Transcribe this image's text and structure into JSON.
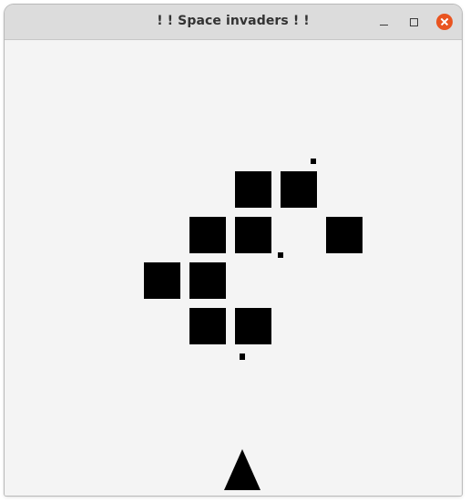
{
  "window": {
    "title": "! ! Space invaders ! !"
  },
  "colors": {
    "titlebar": "#dcdcdc",
    "background": "#f4f4f4",
    "sprites": "#000000",
    "close_button": "#e95420"
  },
  "icons": {
    "minimize": "minimize-icon",
    "maximize": "maximize-icon",
    "close": "close-icon"
  },
  "game": {
    "invader_count": 9,
    "player_shots": 1,
    "enemy_shots": 2
  }
}
